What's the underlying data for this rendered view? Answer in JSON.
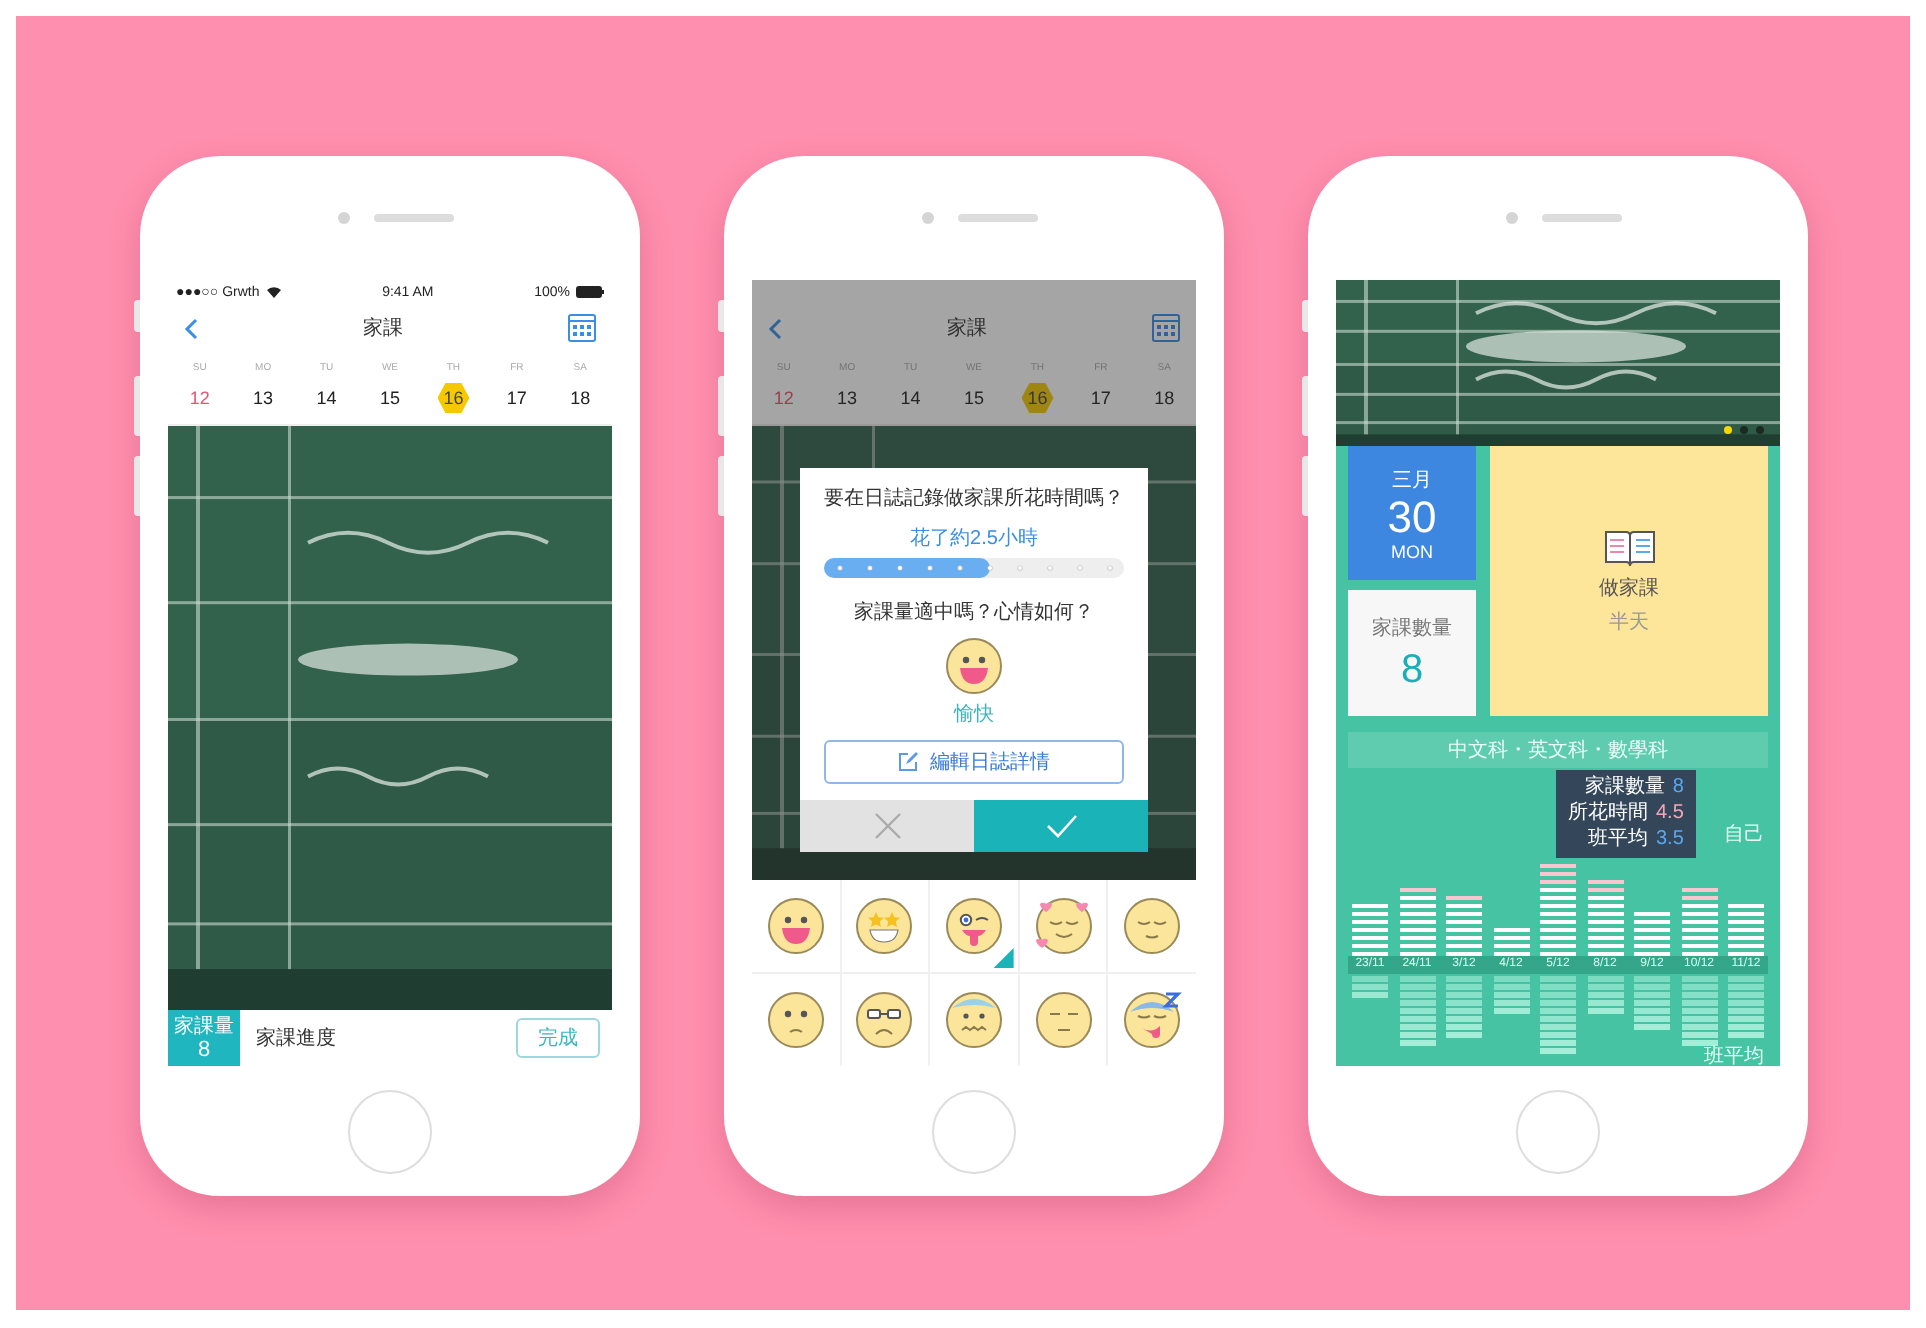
{
  "log_screen": {
    "status_bar": {
      "carrier": "●●●○○ Grwth",
      "time": "9:41 AM",
      "battery": "100%"
    },
    "header": {
      "title": "家課"
    },
    "week": [
      {
        "day": "SU",
        "date": "12",
        "holiday": true,
        "selected": false
      },
      {
        "day": "MO",
        "date": "13",
        "holiday": false,
        "selected": false
      },
      {
        "day": "TU",
        "date": "14",
        "holiday": false,
        "selected": false
      },
      {
        "day": "WE",
        "date": "15",
        "holiday": false,
        "selected": false
      },
      {
        "day": "TH",
        "date": "16",
        "holiday": false,
        "selected": true
      },
      {
        "day": "FR",
        "date": "17",
        "holiday": false,
        "selected": false
      },
      {
        "day": "SA",
        "date": "18",
        "holiday": false,
        "selected": false
      }
    ],
    "bottom_bar": {
      "badge_label": "家課量",
      "badge_value": "8",
      "label": "家課進度",
      "button": "完成"
    }
  },
  "mood_screen": {
    "header": {
      "title": "家課"
    },
    "week": [
      {
        "day": "SU",
        "date": "12",
        "holiday": true,
        "selected": false
      },
      {
        "day": "MO",
        "date": "13",
        "holiday": false,
        "selected": false
      },
      {
        "day": "TU",
        "date": "14",
        "holiday": false,
        "selected": false
      },
      {
        "day": "WE",
        "date": "15",
        "holiday": false,
        "selected": false
      },
      {
        "day": "TH",
        "date": "16",
        "holiday": false,
        "selected": true
      },
      {
        "day": "FR",
        "date": "17",
        "holiday": false,
        "selected": false
      },
      {
        "day": "SA",
        "date": "18",
        "holiday": false,
        "selected": false
      }
    ],
    "dialog": {
      "question": "要在日誌記錄做家課所花時間嗎？",
      "time_hint": "花了約2.5小時",
      "level": 0.55,
      "mood_question": "家課量適中嗎？心情如何？",
      "mood_label": "愉快",
      "edit_button": "編輯日誌詳情"
    },
    "emojis": [
      {
        "kind": "grin",
        "selected": false
      },
      {
        "kind": "star_eyes",
        "selected": false
      },
      {
        "kind": "wink_tongue",
        "selected": true
      },
      {
        "kind": "hearts",
        "selected": false
      },
      {
        "kind": "calm",
        "selected": false
      },
      {
        "kind": "sad",
        "selected": false
      },
      {
        "kind": "grumpy",
        "selected": false
      },
      {
        "kind": "nervous",
        "selected": false
      },
      {
        "kind": "meh",
        "selected": false
      },
      {
        "kind": "sleepy",
        "selected": false
      }
    ]
  },
  "stats_screen": {
    "pager": [
      {
        "selected": true
      },
      {
        "selected": false
      },
      {
        "selected": false
      }
    ],
    "date_card": {
      "month": "三月",
      "day": "30",
      "weekday": "MON"
    },
    "count_card": {
      "label": "家課數量",
      "value": "8"
    },
    "activity_card": {
      "title": "做家課",
      "subtitle": "半天"
    },
    "subjects": "中文科・英文科・數學科",
    "tooltip": [
      {
        "label": "家課數量",
        "value": "8",
        "color": "#5aa8f0"
      },
      {
        "label": "所花時間",
        "value": "4.5",
        "color": "#f0a8b8"
      },
      {
        "label": "班平均",
        "value": "3.5",
        "color": "#5aa8f0"
      }
    ],
    "self_label": "自己",
    "average_label": "班平均",
    "dates": [
      "23/11",
      "24/11",
      "3/12",
      "4/12",
      "5/12",
      "8/12",
      "9/12",
      "10/12",
      "11/12"
    ]
  }
}
